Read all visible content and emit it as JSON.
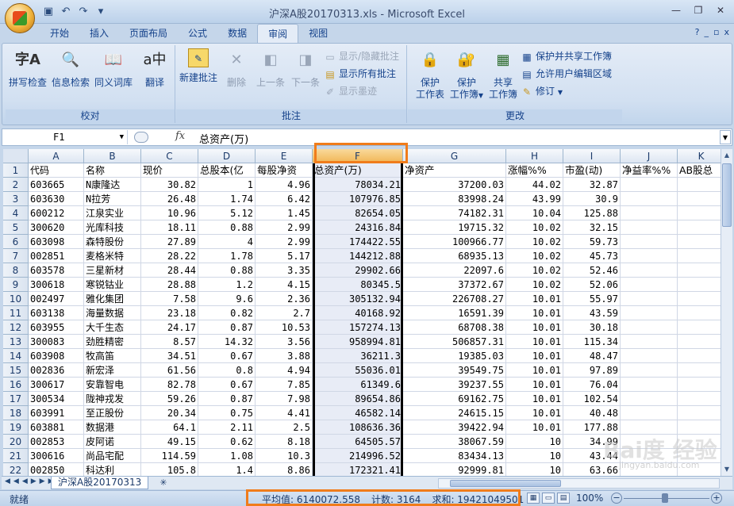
{
  "window": {
    "title": "沪深A股20170313.xls - Microsoft Excel",
    "controls": [
      "—",
      "❐",
      "✕"
    ]
  },
  "quick_access": [
    "save-icon",
    "undo-icon",
    "redo-icon",
    "customize-icon"
  ],
  "ribbon": {
    "tabs": [
      "开始",
      "插入",
      "页面布局",
      "公式",
      "数据",
      "审阅",
      "视图"
    ],
    "active_tab": "审阅",
    "proofing": {
      "label": "校对",
      "buttons": [
        "拼写检查",
        "信息检索",
        "同义词库",
        "翻译"
      ]
    },
    "comments": {
      "label": "批注",
      "buttons": [
        "新建批注",
        "删除",
        "上一条",
        "下一条"
      ],
      "small": [
        "显示/隐藏批注",
        "显示所有批注",
        "显示墨迹"
      ]
    },
    "changes": {
      "label": "更改",
      "big": [
        [
          "保护",
          "工作表"
        ],
        [
          "保护",
          "工作簿"
        ],
        [
          "共享",
          "工作簿"
        ]
      ],
      "small": [
        "保护并共享工作簿",
        "允许用户编辑区域",
        "修订"
      ]
    }
  },
  "formula_bar": {
    "name_box": "F1",
    "fx": "fx",
    "content": "总资产(万)"
  },
  "columns": [
    "A",
    "B",
    "C",
    "D",
    "E",
    "F",
    "G",
    "H",
    "I",
    "J",
    "K"
  ],
  "selected_column": "F",
  "header_row": [
    "代码",
    "名称",
    "现价",
    "总股本(亿",
    "每股净资",
    "总资产(万)",
    "净资产",
    "涨幅%%",
    "市盈(动)",
    "净益率%%",
    "AB股总"
  ],
  "rows": [
    [
      "603665",
      "N康隆达",
      "30.82",
      "1",
      "4.96",
      "78034.21",
      "37200.03",
      "44.02",
      "32.87"
    ],
    [
      "603630",
      "N拉芳",
      "26.48",
      "1.74",
      "6.42",
      "107976.85",
      "83998.24",
      "43.99",
      "30.9"
    ],
    [
      "600212",
      "江泉实业",
      "10.96",
      "5.12",
      "1.45",
      "82654.05",
      "74182.31",
      "10.04",
      "125.88"
    ],
    [
      "300620",
      "光库科技",
      "18.11",
      "0.88",
      "2.99",
      "24316.84",
      "19715.32",
      "10.02",
      "32.15"
    ],
    [
      "603098",
      "森特股份",
      "27.89",
      "4",
      "2.99",
      "174422.55",
      "100966.77",
      "10.02",
      "59.73"
    ],
    [
      "002851",
      "麦格米特",
      "28.22",
      "1.78",
      "5.17",
      "144212.88",
      "68935.13",
      "10.02",
      "45.73"
    ],
    [
      "603578",
      "三星新材",
      "28.44",
      "0.88",
      "3.35",
      "29902.66",
      "22097.6",
      "10.02",
      "52.46"
    ],
    [
      "300618",
      "寒锐钴业",
      "28.88",
      "1.2",
      "4.15",
      "80345.5",
      "37372.67",
      "10.02",
      "52.06"
    ],
    [
      "002497",
      "雅化集团",
      "7.58",
      "9.6",
      "2.36",
      "305132.94",
      "226708.27",
      "10.01",
      "55.97"
    ],
    [
      "603138",
      "海量数据",
      "23.18",
      "0.82",
      "2.7",
      "40168.92",
      "16591.39",
      "10.01",
      "43.59"
    ],
    [
      "603955",
      "大千生态",
      "24.17",
      "0.87",
      "10.53",
      "157274.13",
      "68708.38",
      "10.01",
      "30.18"
    ],
    [
      "300083",
      "劲胜精密",
      "8.57",
      "14.32",
      "3.56",
      "958994.81",
      "506857.31",
      "10.01",
      "115.34"
    ],
    [
      "603908",
      "牧高笛",
      "34.51",
      "0.67",
      "3.88",
      "36211.3",
      "19385.03",
      "10.01",
      "48.47"
    ],
    [
      "002836",
      "新宏泽",
      "61.56",
      "0.8",
      "4.94",
      "55036.01",
      "39549.75",
      "10.01",
      "97.89"
    ],
    [
      "300617",
      "安靠智电",
      "82.78",
      "0.67",
      "7.85",
      "61349.6",
      "39237.55",
      "10.01",
      "76.04"
    ],
    [
      "300534",
      "陇神戎发",
      "59.26",
      "0.87",
      "7.98",
      "89654.86",
      "69162.75",
      "10.01",
      "102.54"
    ],
    [
      "603991",
      "至正股份",
      "20.34",
      "0.75",
      "4.41",
      "46582.14",
      "24615.15",
      "10.01",
      "40.48"
    ],
    [
      "603881",
      "数据港",
      "64.1",
      "2.11",
      "2.5",
      "108636.36",
      "39422.94",
      "10.01",
      "177.88"
    ],
    [
      "002853",
      "皮阿诺",
      "49.15",
      "0.62",
      "8.18",
      "64505.57",
      "38067.59",
      "10",
      "34.99"
    ],
    [
      "300616",
      "尚品宅配",
      "114.59",
      "1.08",
      "10.3",
      "214996.52",
      "83434.13",
      "10",
      "43.44"
    ],
    [
      "002850",
      "科达利",
      "105.8",
      "1.4",
      "8.86",
      "172321.41",
      "92999.81",
      "10",
      "63.66"
    ]
  ],
  "sheet_tab": "沪深A股20170313",
  "status": {
    "ready": "就绪",
    "average": "平均值: 6140072.558",
    "count": "计数: 3164",
    "sum": "求和: 19421049501",
    "zoom": "100%"
  },
  "watermark": {
    "brand": "Bai度 经验",
    "url": "jingyan.baidu.com"
  },
  "colors": {
    "annotation": "#f07c1b",
    "selected_header": "#f1b656",
    "ribbon_text": "#15428b"
  }
}
